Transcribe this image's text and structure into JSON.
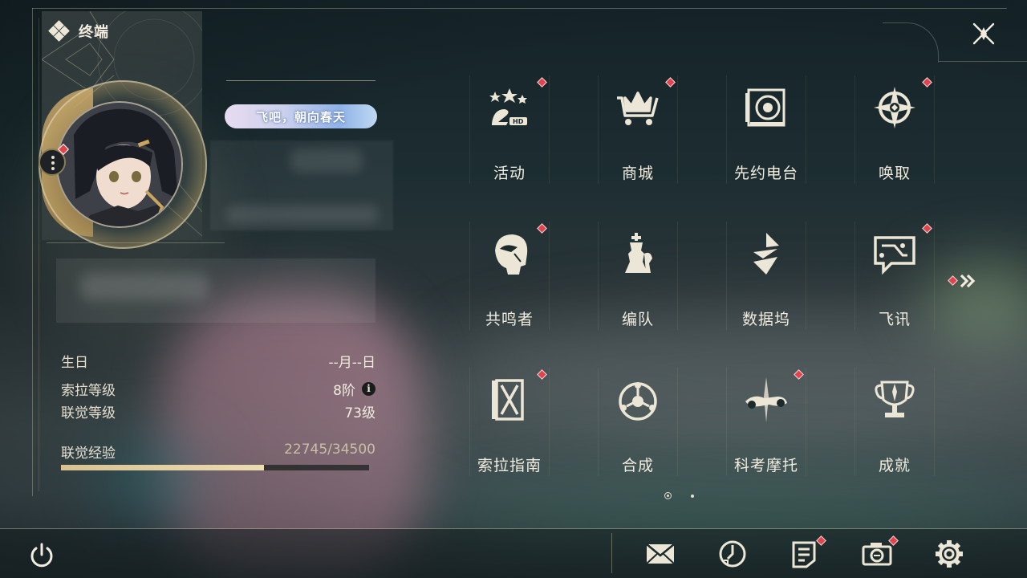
{
  "header": {
    "title": "终端"
  },
  "profile": {
    "title_badge": "飞吧，朝向春天",
    "stats": [
      {
        "label": "生日",
        "value": "--月--日"
      },
      {
        "label": "索拉等级",
        "value": "8阶",
        "info": "i"
      },
      {
        "label": "联觉等级",
        "value": "73级"
      }
    ],
    "exp": {
      "label": "联觉经验",
      "value": "22745/34500",
      "current": 22745,
      "max": 34500
    }
  },
  "menu": [
    {
      "label": "活动",
      "icon": "activity-2hd-icon",
      "badge": true
    },
    {
      "label": "商城",
      "icon": "shop-cart-icon",
      "badge": true
    },
    {
      "label": "先约电台",
      "icon": "radio-icon",
      "badge": false
    },
    {
      "label": "唤取",
      "icon": "convene-compass-icon",
      "badge": true
    },
    {
      "label": "共鸣者",
      "icon": "resonator-head-icon",
      "badge": true
    },
    {
      "label": "编队",
      "icon": "team-chess-icon",
      "badge": false
    },
    {
      "label": "数据坞",
      "icon": "data-bank-icon",
      "badge": false
    },
    {
      "label": "飞讯",
      "icon": "messenger-bubble-icon",
      "badge": true
    },
    {
      "label": "索拉指南",
      "icon": "guidebook-icon",
      "badge": true
    },
    {
      "label": "合成",
      "icon": "synthesis-icon",
      "badge": false
    },
    {
      "label": "科考摩托",
      "icon": "motorbike-icon",
      "badge": true
    },
    {
      "label": "成就",
      "icon": "trophy-icon",
      "badge": false
    }
  ],
  "toolbar": [
    {
      "name": "mail",
      "icon": "mail-icon",
      "badge": false
    },
    {
      "name": "clock",
      "icon": "clock-icon",
      "badge": false
    },
    {
      "name": "notes",
      "icon": "notice-icon",
      "badge": true
    },
    {
      "name": "camera",
      "icon": "camera-icon",
      "badge": true
    },
    {
      "name": "settings",
      "icon": "gear-icon",
      "badge": false
    }
  ],
  "pager": {
    "pages": 2,
    "current": 1
  },
  "colors": {
    "accent": "#e0454f",
    "text": "#f1ecdf",
    "exp_fill": "#d8c292"
  }
}
